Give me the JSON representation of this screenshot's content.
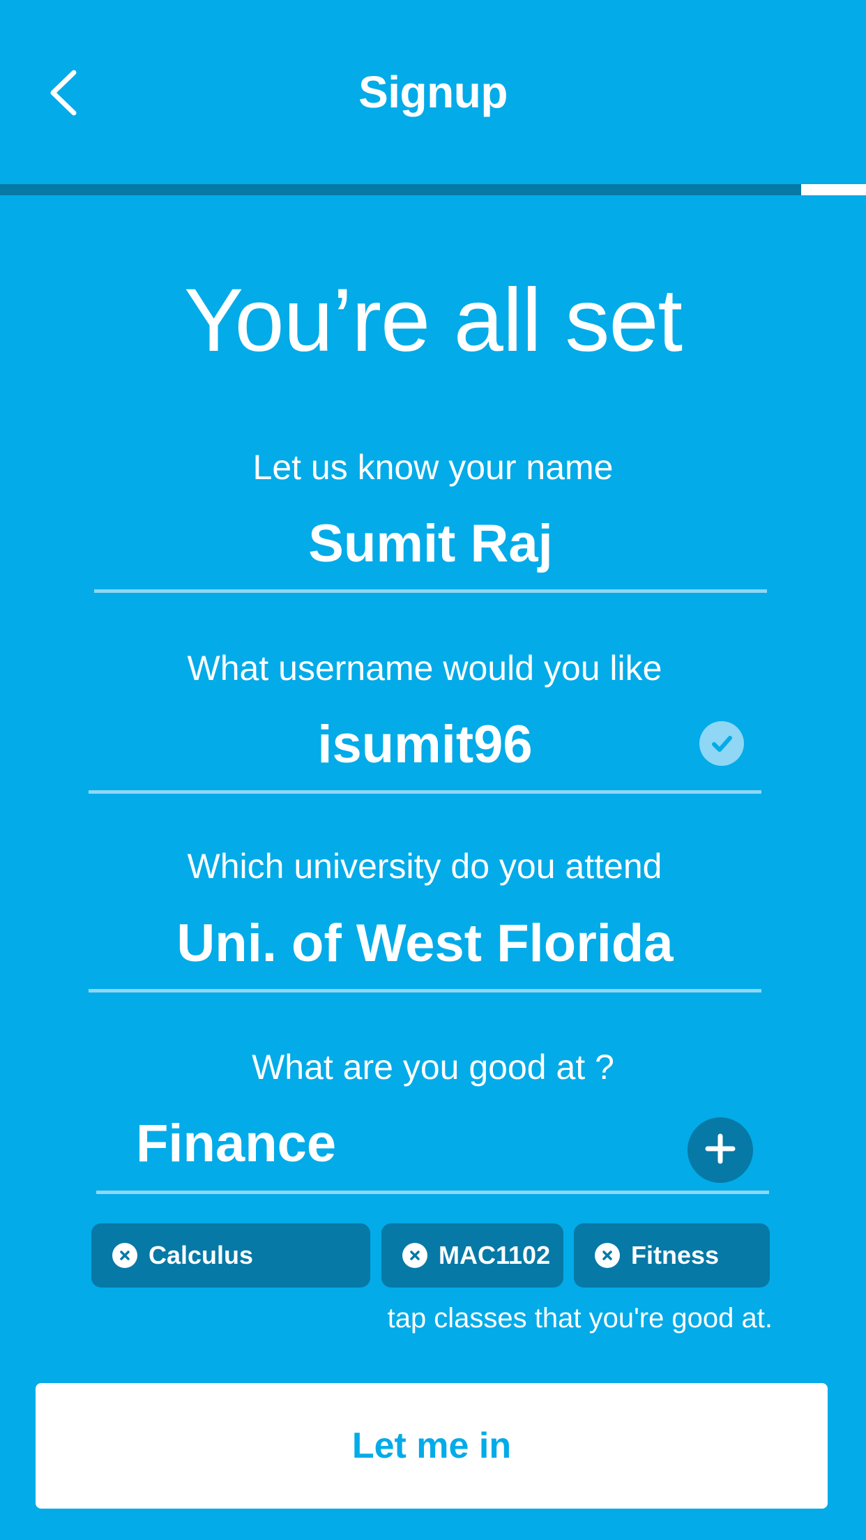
{
  "colors": {
    "background": "#03abe8",
    "accent_dark": "#0679a6",
    "underline": "#8fd7f5",
    "white": "#ffffff"
  },
  "header": {
    "title": "Signup",
    "back_icon": "chevron-left-icon",
    "progress_fraction": 0.925
  },
  "headline": "You’re all set",
  "fields": {
    "name": {
      "label": "Let us know your name",
      "value": "Sumit Raj"
    },
    "username": {
      "label": "What username would you like",
      "value": "isumit96",
      "status_icon": "check-circle-icon"
    },
    "university": {
      "label": "Which university do you attend",
      "value": "Uni. of West Florida"
    },
    "skills": {
      "label": "What are you good at ?",
      "value": "Finance",
      "add_icon": "plus-icon"
    }
  },
  "chips": [
    {
      "label": "Calculus",
      "icon": "remove-circle-icon"
    },
    {
      "label": "MAC1102",
      "icon": "remove-circle-icon"
    },
    {
      "label": "Fitness",
      "icon": "remove-circle-icon"
    }
  ],
  "hint": "tap classes that you're good at.",
  "cta": {
    "label": "Let me in"
  }
}
